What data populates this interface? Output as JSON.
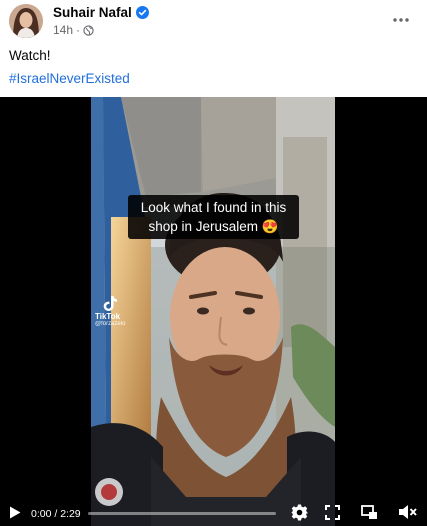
{
  "post": {
    "author": "Suhair Nafal",
    "time": "14h",
    "verified": true,
    "text": "Watch!",
    "hashtag": "#IsraelNeverExisted"
  },
  "video": {
    "caption": "Look what I found in this shop in Jerusalem 😍",
    "watermark_brand": "TikTok",
    "watermark_handle": "@forzazelo",
    "time_display": "0:00 / 2:29",
    "progress_fraction": 0.0
  },
  "icons": {
    "verified": "verified-badge-icon",
    "privacy": "globe-icon",
    "more": "more-dots-icon",
    "play": "play-icon",
    "settings": "gear-icon",
    "fullscreen": "fullscreen-icon",
    "pip": "picture-in-picture-icon",
    "volume": "muted-volume-icon"
  },
  "colors": {
    "link": "#216fdb",
    "verified": "#1877f2",
    "meta_text": "#65676b"
  }
}
